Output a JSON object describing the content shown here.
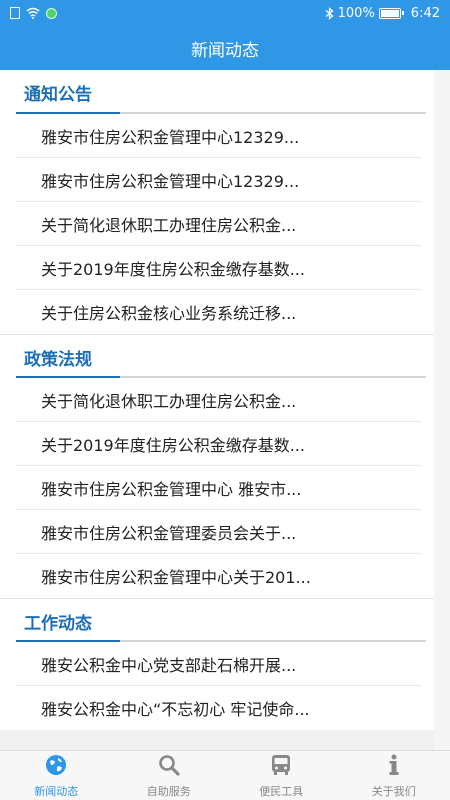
{
  "status_bar": {
    "battery_percent": "100%",
    "time": "6:42",
    "battery_level": 1.0
  },
  "header": {
    "title": "新闻动态"
  },
  "sections": [
    {
      "title": "通知公告",
      "items": [
        "雅安市住房公积金管理中心12329...",
        "雅安市住房公积金管理中心12329...",
        "关于简化退休职工办理住房公积金...",
        "关于2019年度住房公积金缴存基数...",
        "关于住房公积金核心业务系统迁移..."
      ]
    },
    {
      "title": "政策法规",
      "items": [
        "关于简化退休职工办理住房公积金...",
        "关于2019年度住房公积金缴存基数...",
        "雅安市住房公积金管理中心 雅安市...",
        "雅安市住房公积金管理委员会关于...",
        "雅安市住房公积金管理中心关于201..."
      ]
    },
    {
      "title": "工作动态",
      "items": [
        "雅安公积金中心党支部赴石棉开展...",
        "雅安公积金中心“不忘初心 牢记使命..."
      ]
    }
  ],
  "tabs": [
    {
      "label": "新闻动态",
      "icon": "globe-icon",
      "active": true
    },
    {
      "label": "自助服务",
      "icon": "search-icon",
      "active": false
    },
    {
      "label": "便民工具",
      "icon": "bus-icon",
      "active": false
    },
    {
      "label": "关于我们",
      "icon": "info-icon",
      "active": false
    }
  ],
  "colors": {
    "primary": "#2f97e6",
    "section_title": "#1f6fb5",
    "tab_inactive": "#888888"
  }
}
